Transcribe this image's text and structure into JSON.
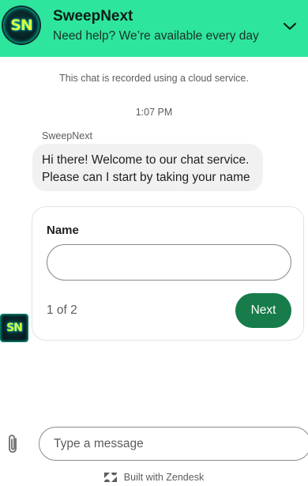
{
  "header": {
    "avatar_text": "SN",
    "title": "SweepNext",
    "subtitle": "Need help? We’re available every day",
    "collapse_icon": "chevron-down-icon"
  },
  "chat": {
    "notice": "This chat is recorded using a cloud service.",
    "timestamp": "1:07 PM",
    "sender": "SweepNext",
    "message_lines": [
      "Hi there! Welcome to our chat service.",
      "Please can I start by taking your name"
    ],
    "bot_avatar_text": "SN"
  },
  "form": {
    "label": "Name",
    "value": "",
    "placeholder": "",
    "steps": "1 of 2",
    "next_label": "Next"
  },
  "composer": {
    "placeholder": "Type a message",
    "attach_icon": "paperclip-icon"
  },
  "footer": {
    "text": "Built with Zendesk",
    "icon": "zendesk-icon"
  },
  "colors": {
    "header_bg": "#2ee59d",
    "primary_button": "#177c4a",
    "bubble_bg": "#f1f1f1"
  }
}
